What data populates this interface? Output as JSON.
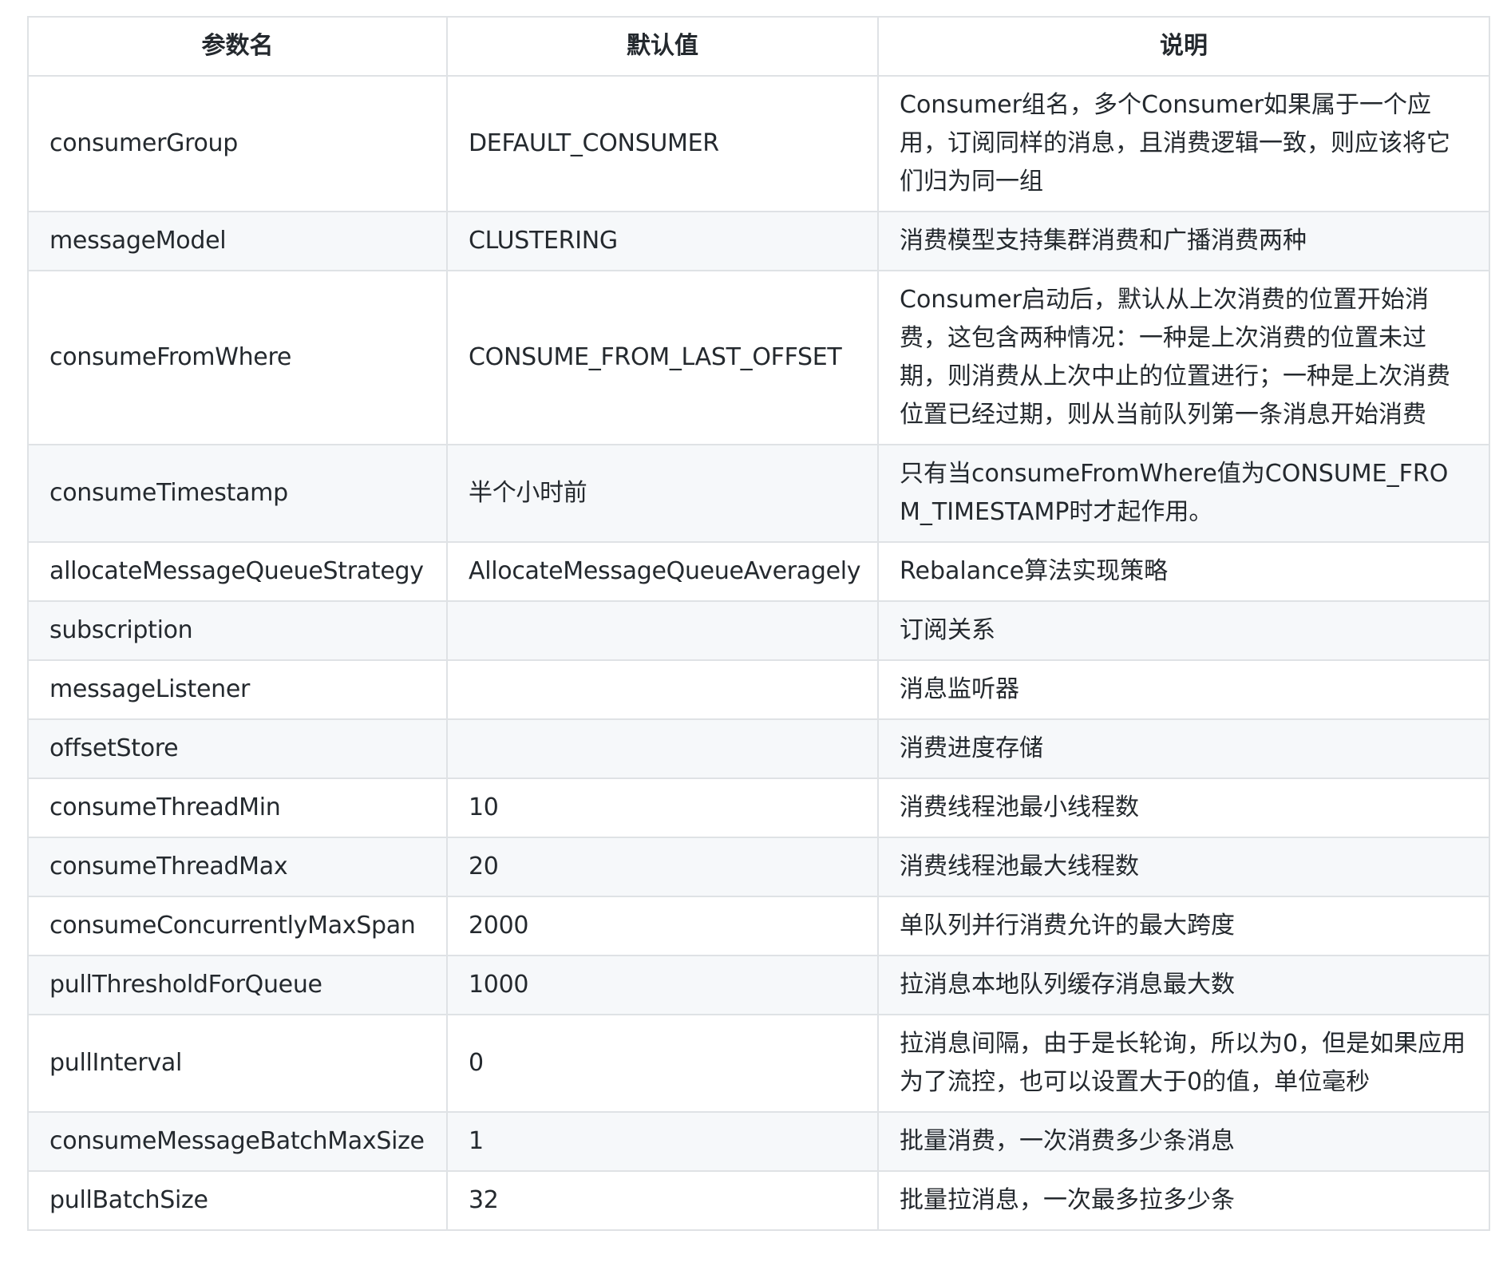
{
  "table": {
    "headers": [
      "参数名",
      "默认值",
      "说明"
    ],
    "rows": [
      {
        "name": "consumerGroup",
        "default": "DEFAULT_CONSUMER",
        "desc": "Consumer组名，多个Consumer如果属于一个应用，订阅同样的消息，且消费逻辑一致，则应该将它们归为同一组"
      },
      {
        "name": "messageModel",
        "default": "CLUSTERING",
        "desc": "消费模型支持集群消费和广播消费两种"
      },
      {
        "name": "consumeFromWhere",
        "default": "CONSUME_FROM_LAST_OFFSET",
        "desc": "Consumer启动后，默认从上次消费的位置开始消费，这包含两种情况：一种是上次消费的位置未过期，则消费从上次中止的位置进行；一种是上次消费位置已经过期，则从当前队列第一条消息开始消费"
      },
      {
        "name": "consumeTimestamp",
        "default": "半个小时前",
        "desc": "只有当consumeFromWhere值为CONSUME_FROM_TIMESTAMP时才起作用。"
      },
      {
        "name": "allocateMessageQueueStrategy",
        "default": "AllocateMessageQueueAveragely",
        "desc": "Rebalance算法实现策略"
      },
      {
        "name": "subscription",
        "default": "",
        "desc": "订阅关系"
      },
      {
        "name": "messageListener",
        "default": "",
        "desc": "消息监听器"
      },
      {
        "name": "offsetStore",
        "default": "",
        "desc": "消费进度存储"
      },
      {
        "name": "consumeThreadMin",
        "default": "10",
        "desc": "消费线程池最小线程数"
      },
      {
        "name": "consumeThreadMax",
        "default": "20",
        "desc": "消费线程池最大线程数"
      },
      {
        "name": "consumeConcurrentlyMaxSpan",
        "default": "2000",
        "desc": "单队列并行消费允许的最大跨度"
      },
      {
        "name": "pullThresholdForQueue",
        "default": "1000",
        "desc": "拉消息本地队列缓存消息最大数"
      },
      {
        "name": "pullInterval",
        "default": "0",
        "desc": "拉消息间隔，由于是长轮询，所以为0，但是如果应用为了流控，也可以设置大于0的值，单位毫秒"
      },
      {
        "name": "consumeMessageBatchMaxSize",
        "default": "1",
        "desc": "批量消费，一次消费多少条消息"
      },
      {
        "name": "pullBatchSize",
        "default": "32",
        "desc": "批量拉消息，一次最多拉多少条"
      }
    ]
  }
}
